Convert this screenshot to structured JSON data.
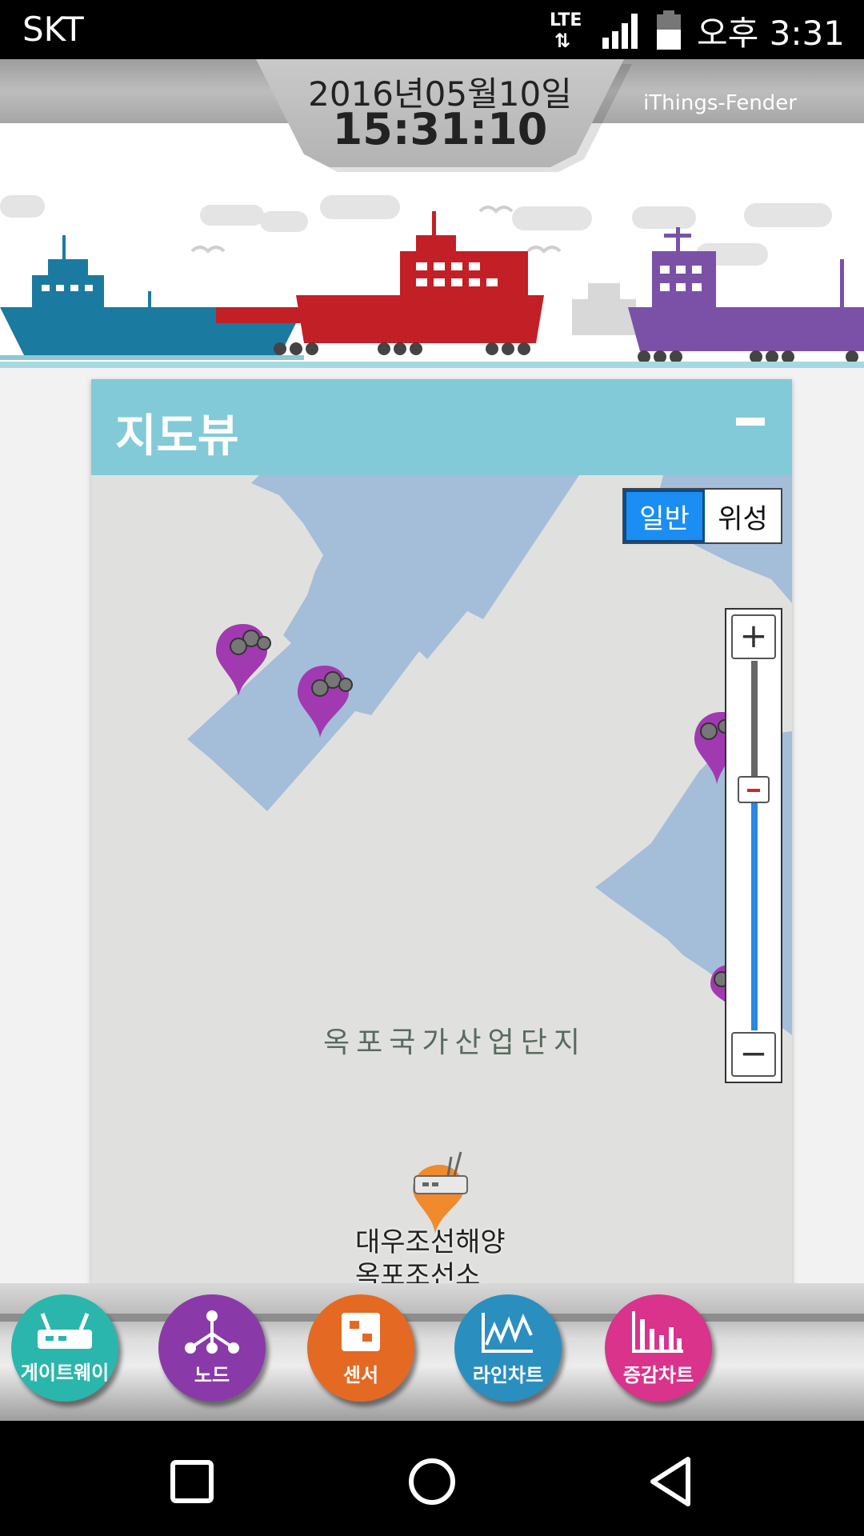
{
  "status_bar": {
    "carrier": "SKT",
    "network": "LTE",
    "data_arrows": "⇅",
    "time": "오후 3:31"
  },
  "header": {
    "date": "2016년05월10일",
    "time": "15:31:10",
    "brand": "iThings-Fender"
  },
  "panel": {
    "title": "지도뷰",
    "map_type": {
      "normal": "일반",
      "satellite": "위성",
      "selected": "normal"
    },
    "zoom": {
      "plus": "+",
      "minus": "−"
    },
    "area_label": "옥포국가산업단지",
    "place_label_line1": "대우조선해양",
    "place_label_line2": "옥포조선소"
  },
  "toolbar": {
    "items": [
      {
        "label": "게이트웨이",
        "color": "#2bb6ad",
        "icon": "router-icon"
      },
      {
        "label": "노드",
        "color": "#8a3aa8",
        "icon": "network-node-icon"
      },
      {
        "label": "센서",
        "color": "#e46a24",
        "icon": "sensor-chip-icon"
      },
      {
        "label": "라인차트",
        "color": "#2a8fbf",
        "icon": "line-chart-icon"
      },
      {
        "label": "증감차트",
        "color": "#d9338c",
        "icon": "bar-chart-icon"
      }
    ]
  },
  "colors": {
    "water": "#a4bdd9",
    "land": "#e0e1de",
    "panel_header": "#82cad8",
    "marker_purple": "#a13ab0",
    "marker_orange": "#f08a2c"
  }
}
